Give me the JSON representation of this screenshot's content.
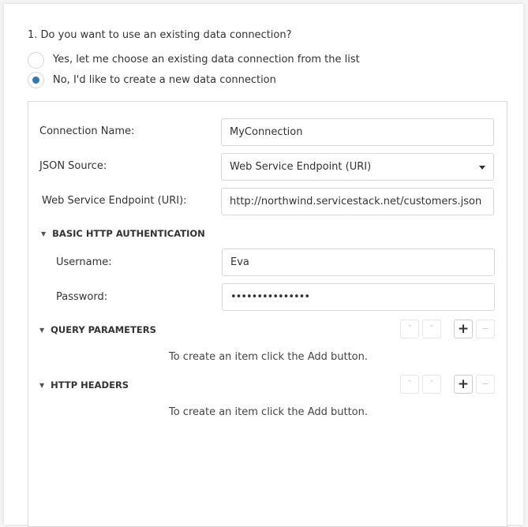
{
  "question": "1. Do you want to use an existing data connection?",
  "options": [
    {
      "label": "Yes, let me choose an existing data connection from the list",
      "selected": false
    },
    {
      "label": "No, I'd like to create a new data connection",
      "selected": true
    }
  ],
  "accent": "#2f76c3",
  "form": {
    "connection_name": {
      "label": "Connection Name:",
      "value": "MyConnection"
    },
    "json_source": {
      "label": "JSON Source:",
      "value": "Web Service Endpoint (URI)"
    },
    "endpoint": {
      "label": "Web Service Endpoint (URI):",
      "value": "http://northwind.servicestack.net/customers.json"
    },
    "auth": {
      "title": "BASIC HTTP AUTHENTICATION",
      "username_label": "Username:",
      "username": "Eva",
      "password_label": "Password:",
      "password": "•••••••••••••••"
    },
    "query_params": {
      "title": "QUERY PARAMETERS",
      "empty": "To create an item click the Add button."
    },
    "http_headers": {
      "title": "HTTP HEADERS",
      "empty": "To create an item click the Add button."
    }
  },
  "buttons": {
    "up": "˄",
    "down": "˅",
    "add": "+",
    "remove": "−",
    "collapse": "▼"
  }
}
